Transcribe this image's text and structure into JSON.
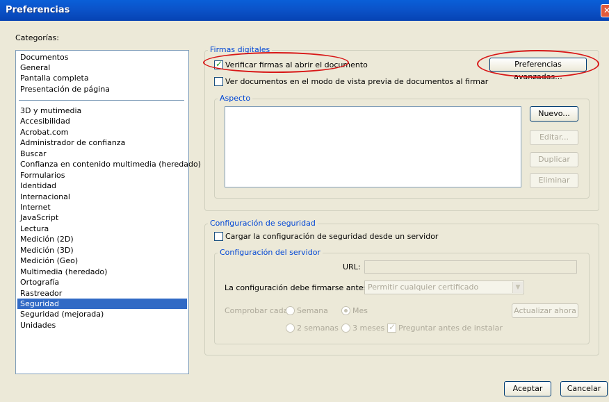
{
  "window": {
    "title": "Preferencias",
    "close_glyph": "✕"
  },
  "categories": {
    "label": "Categorías:",
    "group_top": [
      "Documentos",
      "General",
      "Pantalla completa",
      "Presentación de página"
    ],
    "group_bottom": [
      "3D y mutimedia",
      "Accesibilidad",
      "Acrobat.com",
      "Administrador de confianza",
      "Buscar",
      "Confianza en contenido multimedia (heredado)",
      "Formularios",
      "Identidad",
      "Internacional",
      "Internet",
      "JavaScript",
      "Lectura",
      "Medición (2D)",
      "Medición (3D)",
      "Medición (Geo)",
      "Multimedia (heredado)",
      "Ortografía",
      "Rastreador",
      "Seguridad",
      "Seguridad (mejorada)",
      "Unidades"
    ],
    "selected": "Seguridad"
  },
  "firmas": {
    "title": "Firmas digitales",
    "verify_label": "Verificar firmas al abrir el documento",
    "verify_checked": true,
    "preview_label": "Ver documentos en el modo de vista previa de documentos al firmar",
    "preview_checked": false,
    "advanced_button": "Preferencias avanzadas...",
    "aspecto": {
      "title": "Aspecto",
      "new_button": "Nuevo...",
      "edit_button": "Editar...",
      "duplicate_button": "Duplicar",
      "delete_button": "Eliminar"
    }
  },
  "seguridad": {
    "title": "Configuración de seguridad",
    "load_label": "Cargar la configuración de seguridad desde un servidor",
    "load_checked": false,
    "servidor": {
      "title": "Configuración del servidor",
      "url_label": "URL:",
      "url_value": "",
      "sign_label": "La configuración debe firmarse antes del:",
      "sign_value": "Permitir cualquier certificado",
      "check_label": "Comprobar cada:",
      "radio_options": [
        "Semana",
        "Mes",
        "2 semanas",
        "3 meses"
      ],
      "radio_selected": "Mes",
      "ask_label": "Preguntar antes de instalar",
      "ask_checked": true,
      "update_button": "Actualizar ahora"
    }
  },
  "footer": {
    "ok_button": "Aceptar",
    "cancel_button": "Cancelar"
  },
  "annotation_color": "#d81717"
}
